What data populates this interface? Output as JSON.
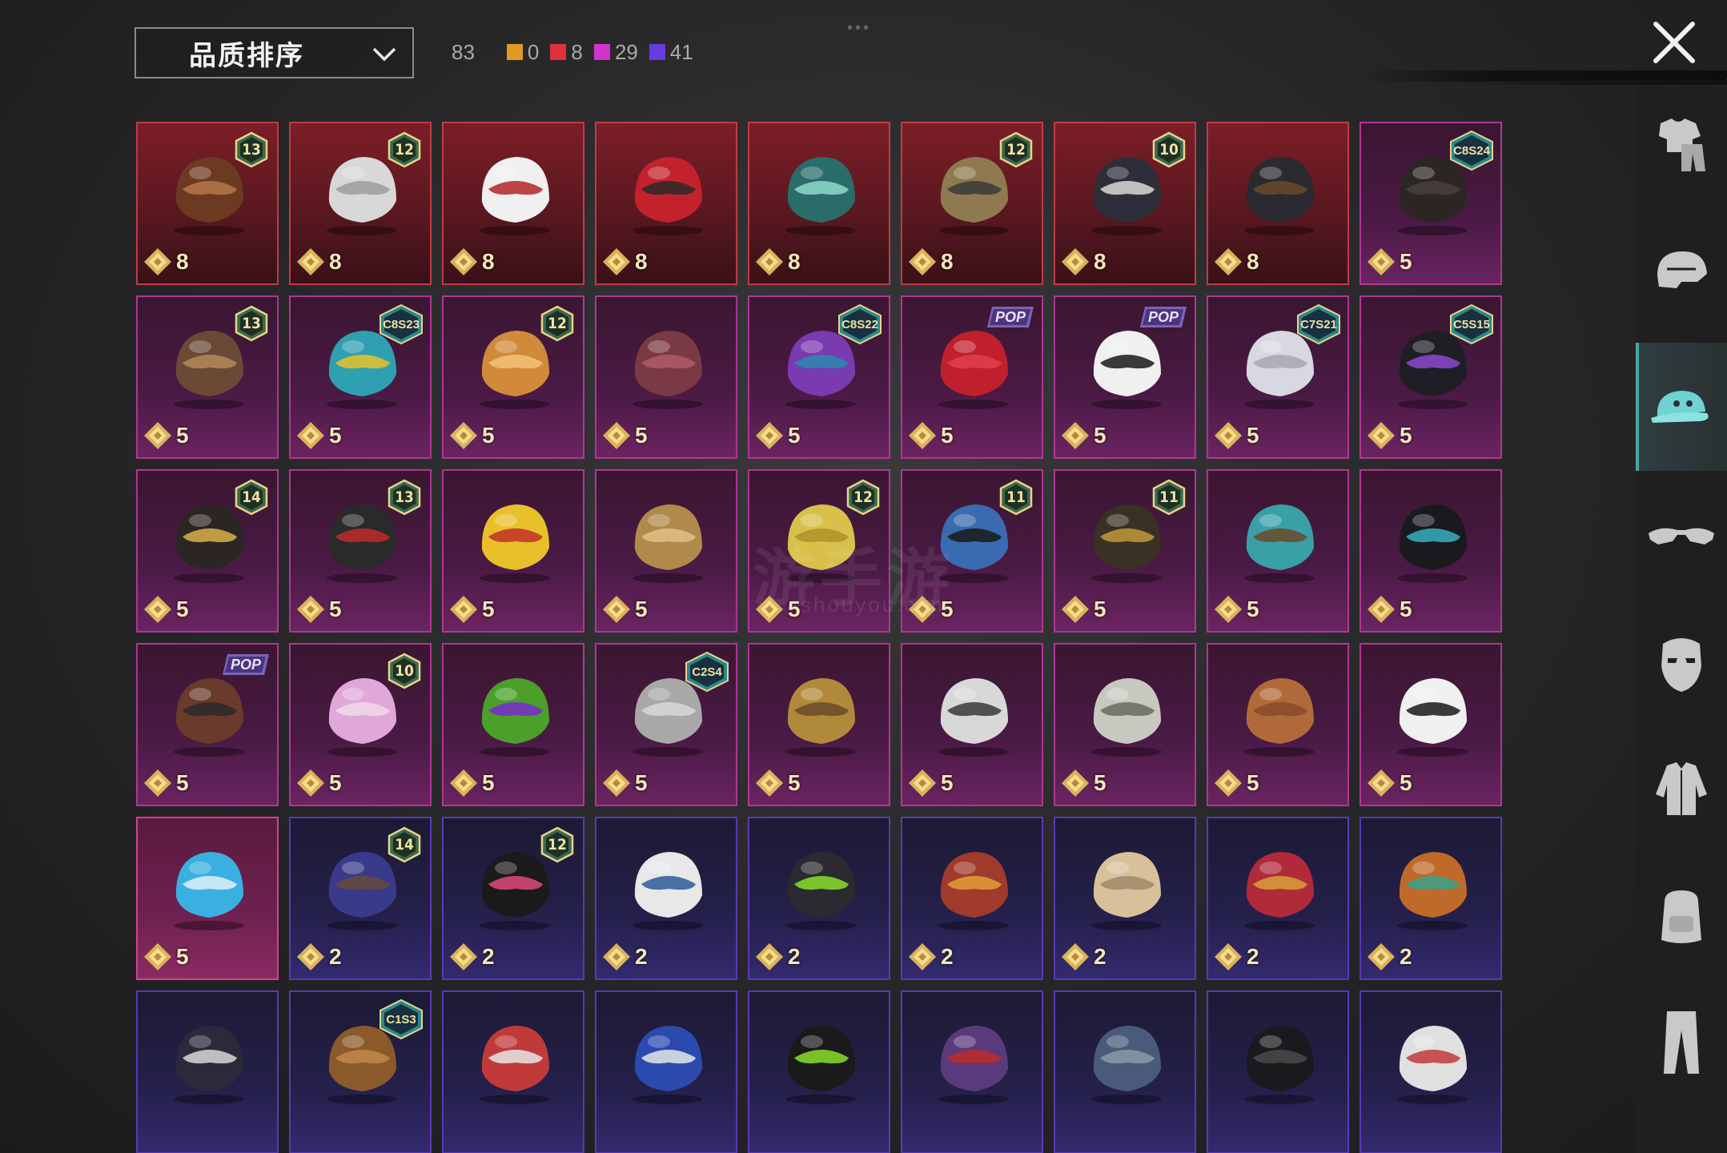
{
  "header": {
    "sort_label": "品质排序",
    "total_count": "83",
    "stats": [
      {
        "color": "#e39a22",
        "count": "0"
      },
      {
        "color": "#e0313a",
        "count": "8"
      },
      {
        "color": "#d035c8",
        "count": "29"
      },
      {
        "color": "#6a3be0",
        "count": "41"
      }
    ]
  },
  "sidebar": {
    "items": [
      {
        "name": "outfit-icon"
      },
      {
        "name": "helmet-icon"
      },
      {
        "name": "cap-icon"
      },
      {
        "name": "glasses-icon"
      },
      {
        "name": "mask-icon"
      },
      {
        "name": "jacket-icon"
      },
      {
        "name": "backpack-icon"
      },
      {
        "name": "pants-icon"
      }
    ],
    "active_index": 2,
    "accent": "#4aa5a7"
  },
  "watermark": {
    "title": "游手游",
    "sub": "shouyou.com"
  },
  "items": [
    {
      "rarity": "red",
      "price": "8",
      "badge": "13",
      "art": "hat-hair"
    },
    {
      "rarity": "red",
      "price": "8",
      "badge": "12",
      "art": "white-hair"
    },
    {
      "rarity": "red",
      "price": "8",
      "badge": "",
      "art": "white-cowboy"
    },
    {
      "rarity": "red",
      "price": "8",
      "badge": "",
      "art": "red-helmet"
    },
    {
      "rarity": "red",
      "price": "8",
      "badge": "",
      "art": "dragon-helmet"
    },
    {
      "rarity": "red",
      "price": "8",
      "badge": "12",
      "art": "winged-helmet"
    },
    {
      "rarity": "red",
      "price": "8",
      "badge": "10",
      "art": "bird-helmet"
    },
    {
      "rarity": "red",
      "price": "8",
      "badge": "",
      "art": "dark-helmet"
    },
    {
      "rarity": "pink",
      "price": "5",
      "badge": "C8S24",
      "art": "black-hair"
    },
    {
      "rarity": "pink",
      "price": "5",
      "badge": "13",
      "art": "goggle-hat"
    },
    {
      "rarity": "pink",
      "price": "5",
      "badge": "C8S23",
      "art": "cat-headphones"
    },
    {
      "rarity": "pink",
      "price": "5",
      "badge": "12",
      "art": "orange-hair"
    },
    {
      "rarity": "pink",
      "price": "5",
      "badge": "",
      "art": "red-brown-hair"
    },
    {
      "rarity": "pink",
      "price": "5",
      "badge": "C8S22",
      "art": "purple-hair"
    },
    {
      "rarity": "pink",
      "price": "5",
      "badge": "POP",
      "art": "red-hair"
    },
    {
      "rarity": "pink",
      "price": "5",
      "badge": "POP",
      "art": "panda"
    },
    {
      "rarity": "pink",
      "price": "5",
      "badge": "C7S21",
      "art": "white-fur"
    },
    {
      "rarity": "pink",
      "price": "5",
      "badge": "C5S15",
      "art": "black-cap"
    },
    {
      "rarity": "pink",
      "price": "5",
      "badge": "14",
      "art": "headband-hair"
    },
    {
      "rarity": "pink",
      "price": "5",
      "badge": "13",
      "art": "devil-cap"
    },
    {
      "rarity": "pink",
      "price": "5",
      "badge": "",
      "art": "duck-helmet"
    },
    {
      "rarity": "pink",
      "price": "5",
      "badge": "",
      "art": "straw-hat"
    },
    {
      "rarity": "pink",
      "price": "5",
      "badge": "12",
      "art": "yellow-can"
    },
    {
      "rarity": "pink",
      "price": "5",
      "badge": "11",
      "art": "blue-dread"
    },
    {
      "rarity": "pink",
      "price": "5",
      "badge": "11",
      "art": "pagoda-hat"
    },
    {
      "rarity": "pink",
      "price": "5",
      "badge": "",
      "art": "teal-mask"
    },
    {
      "rarity": "pink",
      "price": "5",
      "badge": "",
      "art": "ninja-mask"
    },
    {
      "rarity": "pink",
      "price": "5",
      "badge": "POP",
      "art": "gas-mask-hood"
    },
    {
      "rarity": "pink",
      "price": "5",
      "badge": "10",
      "art": "pink-helmet"
    },
    {
      "rarity": "pink",
      "price": "5",
      "badge": "",
      "art": "mecha-helmet"
    },
    {
      "rarity": "pink",
      "price": "5",
      "badge": "C2S4",
      "art": "gray-hair"
    },
    {
      "rarity": "pink",
      "price": "5",
      "badge": "",
      "art": "gold-hat"
    },
    {
      "rarity": "pink",
      "price": "5",
      "badge": "",
      "art": "robot-helmet"
    },
    {
      "rarity": "pink",
      "price": "5",
      "badge": "",
      "art": "lion-mask"
    },
    {
      "rarity": "pink",
      "price": "5",
      "badge": "",
      "art": "turban"
    },
    {
      "rarity": "pink",
      "price": "5",
      "badge": "",
      "art": "zebra-mask"
    },
    {
      "rarity": "pinkbright",
      "price": "5",
      "badge": "",
      "art": "blue-feather"
    },
    {
      "rarity": "purple",
      "price": "2",
      "badge": "14",
      "art": "cat-cap-hair"
    },
    {
      "rarity": "purple",
      "price": "2",
      "badge": "12",
      "art": "bunny-helmet"
    },
    {
      "rarity": "purple",
      "price": "2",
      "badge": "",
      "art": "white-cap"
    },
    {
      "rarity": "purple",
      "price": "2",
      "badge": "",
      "art": "green-gasmask"
    },
    {
      "rarity": "purple",
      "price": "2",
      "badge": "",
      "art": "goggle-hair"
    },
    {
      "rarity": "purple",
      "price": "2",
      "badge": "",
      "art": "bunny-pith"
    },
    {
      "rarity": "purple",
      "price": "2",
      "badge": "",
      "art": "red-fez"
    },
    {
      "rarity": "purple",
      "price": "2",
      "badge": "",
      "art": "orange-beanie"
    },
    {
      "rarity": "purple",
      "price": "",
      "badge": "",
      "art": "witch-hat"
    },
    {
      "rarity": "purple",
      "price": "",
      "badge": "C1S3",
      "art": "barrel-hat"
    },
    {
      "rarity": "purple",
      "price": "",
      "badge": "",
      "art": "football-helmet"
    },
    {
      "rarity": "purple",
      "price": "",
      "badge": "",
      "art": "cricket-helmet"
    },
    {
      "rarity": "purple",
      "price": "",
      "badge": "",
      "art": "green-cap"
    },
    {
      "rarity": "purple",
      "price": "",
      "badge": "",
      "art": "purple-tophat"
    },
    {
      "rarity": "purple",
      "price": "",
      "badge": "",
      "art": "gray-cap"
    },
    {
      "rarity": "purple",
      "price": "",
      "badge": "",
      "art": "black-gasmask"
    },
    {
      "rarity": "purple",
      "price": "",
      "badge": "",
      "art": "goggle-helmet"
    }
  ]
}
